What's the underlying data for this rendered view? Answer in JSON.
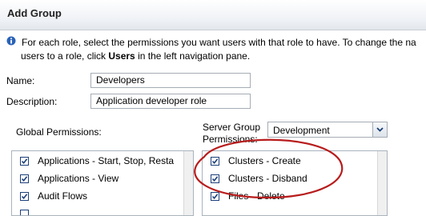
{
  "dialog": {
    "title": "Add Group"
  },
  "info": {
    "line1": "For each role, select the permissions you want users with that role to have. To change the na",
    "line2_before": "users to a role, click ",
    "line2_bold": "Users",
    "line2_after": " in the left navigation pane."
  },
  "form": {
    "name_label": "Name:",
    "name_value": "Developers",
    "description_label": "Description:",
    "description_value": "Application developer role"
  },
  "global_permissions": {
    "label": "Global Permissions:",
    "items": [
      {
        "label": "Applications - Start, Stop, Resta",
        "checked": true
      },
      {
        "label": "Applications - View",
        "checked": true
      },
      {
        "label": "Audit Flows",
        "checked": true
      },
      {
        "label": "",
        "checked": true
      }
    ]
  },
  "server_group_permissions": {
    "label_line1": "Server Group",
    "label_line2": "Permissions:",
    "selected": "Development",
    "items": [
      {
        "label": "Clusters - Create",
        "checked": true
      },
      {
        "label": "Clusters - Disband",
        "checked": true
      },
      {
        "label": "Files - Delete",
        "checked": true
      }
    ]
  },
  "annotation": {
    "color": "#b81c1c"
  },
  "icons": {
    "info": "info-icon",
    "dropdown": "chevron-down-icon",
    "check": "check-icon"
  }
}
